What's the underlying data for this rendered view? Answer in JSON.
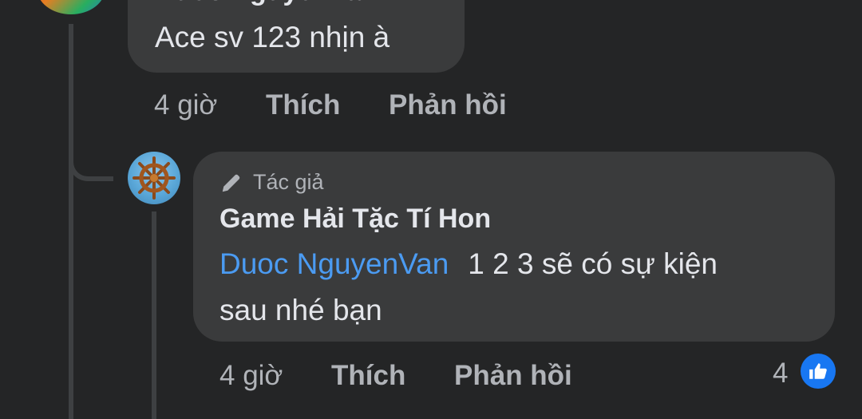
{
  "comment1": {
    "author": "Duoc NguyenVan",
    "text": "Ace sv 123 nhịn à",
    "time": "4 giờ",
    "like_label": "Thích",
    "reply_label": "Phản hồi"
  },
  "reply": {
    "badge_label": "Tác giả",
    "author": "Game Hải Tặc Tí Hon",
    "mention": "Duoc NguyenVan",
    "text_line1": "1 2 3 sẽ có sự kiện",
    "text_line2": "sau nhé bạn",
    "time": "4 giờ",
    "like_label": "Thích",
    "reply_label": "Phản hồi",
    "reaction_count": "4",
    "reaction_icon": "thumbs-up-icon"
  },
  "colors": {
    "background": "#242526",
    "bubble": "#3a3b3c",
    "mention": "#4b9bf2",
    "like_badge": "#1877f2",
    "muted_text": "#b0b3b8"
  }
}
